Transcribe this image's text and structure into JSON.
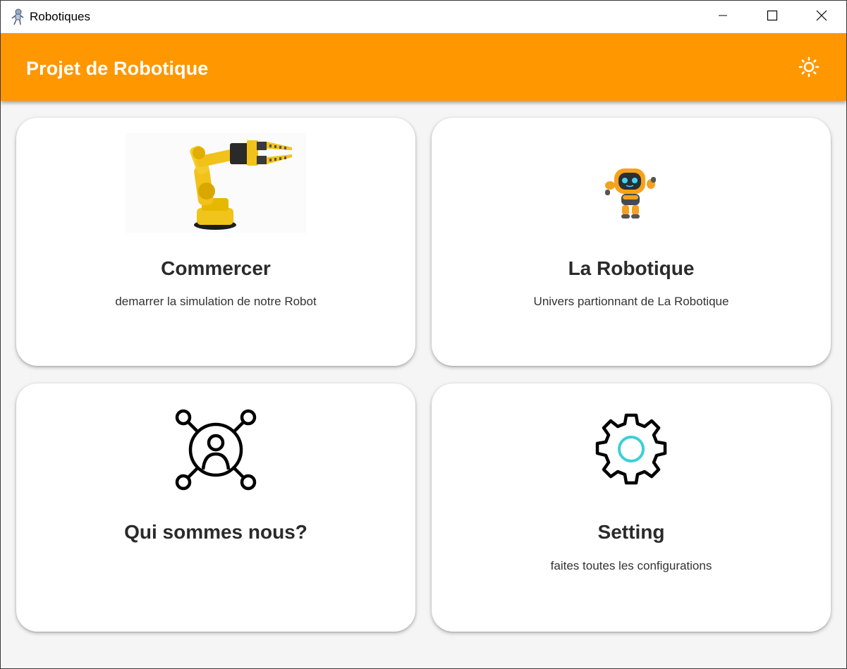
{
  "window": {
    "title": "Robotiques",
    "icon": "robot-app-icon",
    "controls": [
      "minimize-icon",
      "maximize-icon",
      "close-icon"
    ]
  },
  "appbar": {
    "title": "Projet de Robotique",
    "action_icon": "brightness-icon",
    "color": "#fe9700"
  },
  "cards": [
    {
      "title": "Commercer",
      "subtitle": "demarrer la simulation de notre Robot",
      "image": "robotic-arm-image"
    },
    {
      "title": "La Robotique",
      "subtitle": "Univers partionnant de La Robotique",
      "image": "orange-robot-image"
    },
    {
      "title": "Qui sommes nous?",
      "subtitle": "",
      "image": "team-network-icon"
    },
    {
      "title": "Setting",
      "subtitle": "faites toutes les configurations",
      "image": "settings-gear-icon",
      "accent": "#3ccfd6"
    }
  ]
}
